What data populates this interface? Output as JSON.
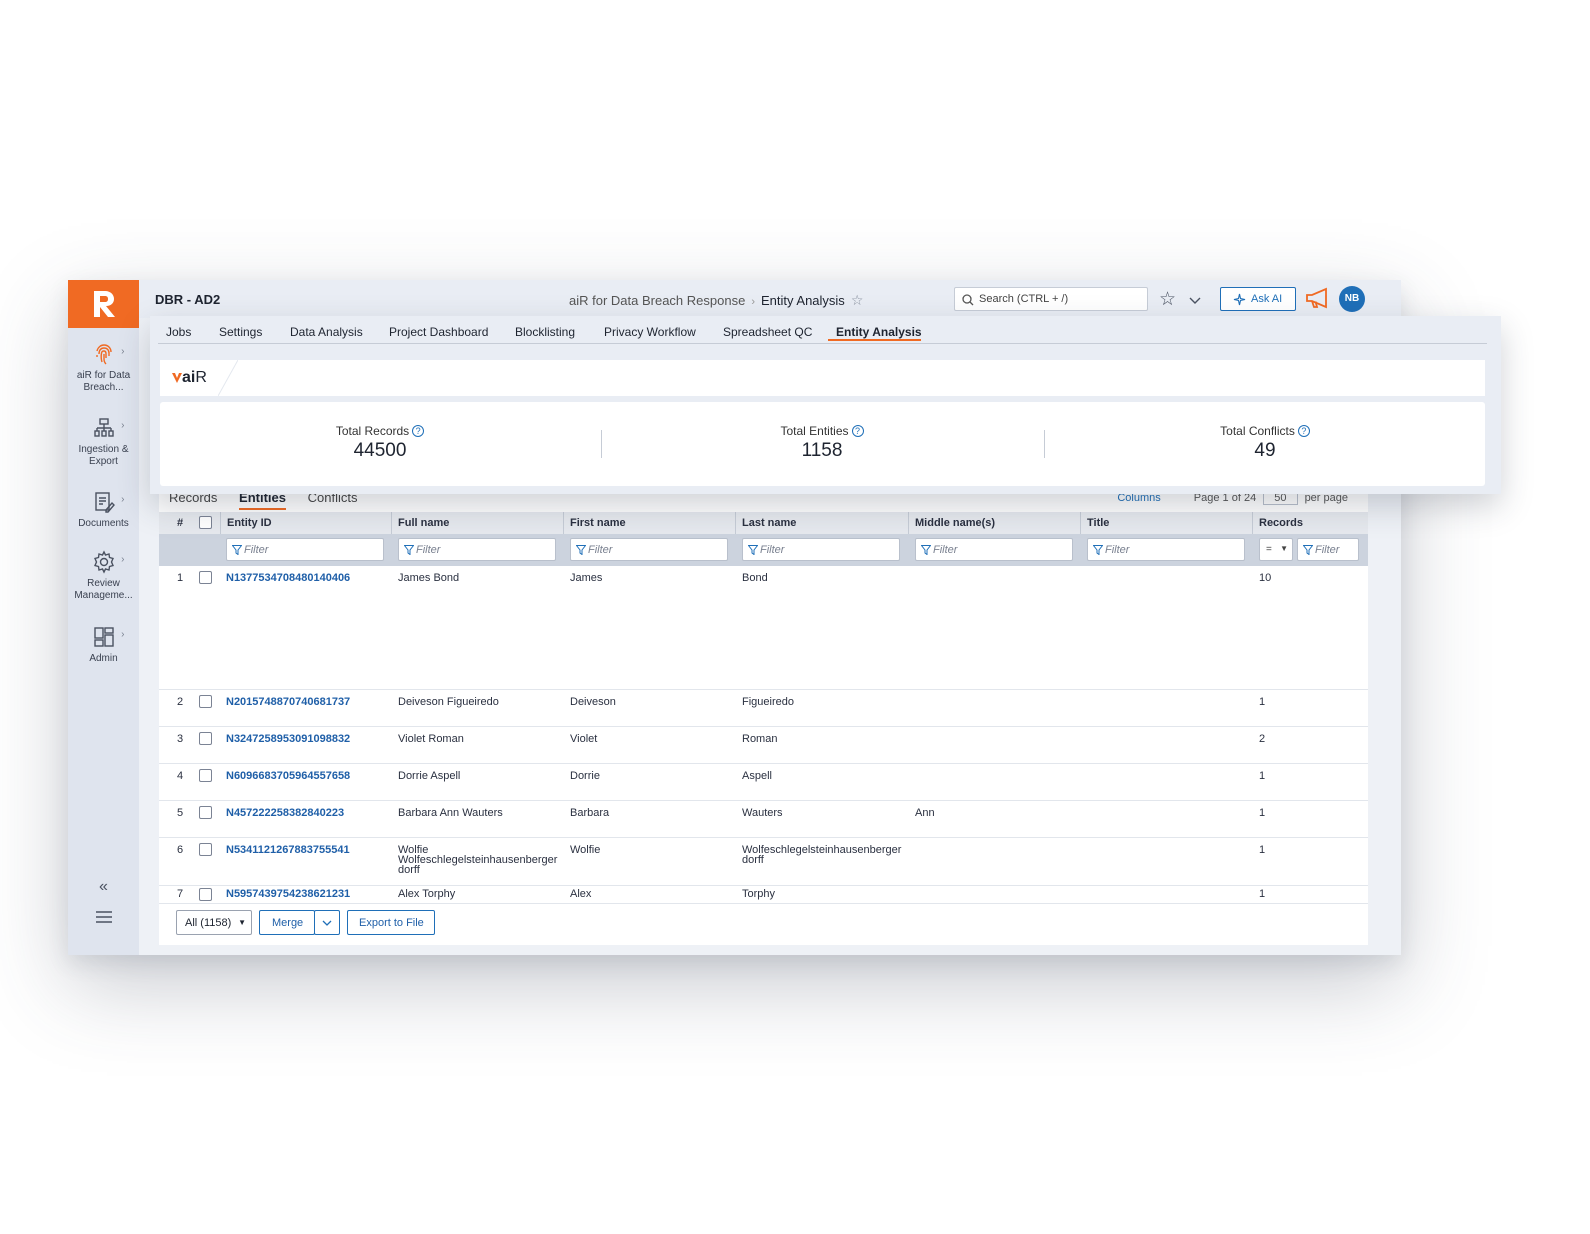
{
  "rail": {
    "items": [
      {
        "label": "aiR for Data Breach...",
        "icon": "fingerprint-icon"
      },
      {
        "label": "Ingestion & Export",
        "icon": "hierarchy-icon"
      },
      {
        "label": "Documents",
        "icon": "document-edit-icon"
      },
      {
        "label": "Review Manageme...",
        "icon": "gear-icon"
      },
      {
        "label": "Admin",
        "icon": "dashboard-grid-icon"
      }
    ],
    "collapse_icon": "double-chevron-left-icon",
    "menu_icon": "hamburger-menu-icon"
  },
  "header": {
    "project": "DBR - AD2",
    "breadcrumb_app": "aiR for Data Breach Response",
    "breadcrumb_page": "Entity Analysis",
    "search_placeholder": "Search (CTRL + /)",
    "ask_ai": "Ask AI",
    "avatar": "NB"
  },
  "tabs": [
    "Jobs",
    "Settings",
    "Data Analysis",
    "Project Dashboard",
    "Blocklisting",
    "Privacy Workflow",
    "Spreadsheet QC",
    "Entity Analysis"
  ],
  "active_tab": "Entity Analysis",
  "air_logo": {
    "prefix": "ai",
    "suffix": "R"
  },
  "stats": [
    {
      "label": "Total Records",
      "value": "44500"
    },
    {
      "label": "Total Entities",
      "value": "1158"
    },
    {
      "label": "Total Conflicts",
      "value": "49"
    }
  ],
  "subtabs": [
    "Records",
    "Entities",
    "Conflicts"
  ],
  "grid_tools": {
    "columns": "Columns",
    "page": "Page 1 of 24",
    "per_page_value": "50",
    "per_page": "per page"
  },
  "grid": {
    "columns": [
      "#",
      "Entity ID",
      "Full name",
      "First name",
      "Last name",
      "Middle name(s)",
      "Title",
      "Records"
    ],
    "filter_placeholder": "Filter",
    "records_operator": "=",
    "rows": [
      {
        "n": "1",
        "id": "N1377534708480140406",
        "full": "James Bond",
        "first": "James",
        "last": "Bond",
        "middle": "",
        "title": "",
        "records": "10"
      },
      {
        "n": "2",
        "id": "N2015748870740681737",
        "full": "Deiveson Figueiredo",
        "first": "Deiveson",
        "last": "Figueiredo",
        "middle": "",
        "title": "",
        "records": "1"
      },
      {
        "n": "3",
        "id": "N3247258953091098832",
        "full": "Violet Roman",
        "first": "Violet",
        "last": "Roman",
        "middle": "",
        "title": "",
        "records": "2"
      },
      {
        "n": "4",
        "id": "N6096683705964557658",
        "full": "Dorrie Aspell",
        "first": "Dorrie",
        "last": "Aspell",
        "middle": "",
        "title": "",
        "records": "1"
      },
      {
        "n": "5",
        "id": "N457222258382840223",
        "full": "Barbara Ann Wauters",
        "first": "Barbara",
        "last": "Wauters",
        "middle": "Ann",
        "title": "",
        "records": "1"
      },
      {
        "n": "6",
        "id": "N5341121267883755541",
        "full": "Wolfie Wolfeschlegelsteinhausenberger dorff",
        "first": "Wolfie",
        "last": "Wolfeschlegelsteinhausenberger dorff",
        "middle": "",
        "title": "",
        "records": "1"
      },
      {
        "n": "7",
        "id": "N5957439754238621231",
        "full": "Alex Torphy",
        "first": "Alex",
        "last": "Torphy",
        "middle": "",
        "title": "",
        "records": "1"
      }
    ]
  },
  "footer": {
    "selector": "All (1158)",
    "merge": "Merge",
    "export": "Export to File"
  },
  "colors": {
    "accent": "#f06a23",
    "link": "#1f5fa8",
    "primary": "#1f6fb8"
  }
}
